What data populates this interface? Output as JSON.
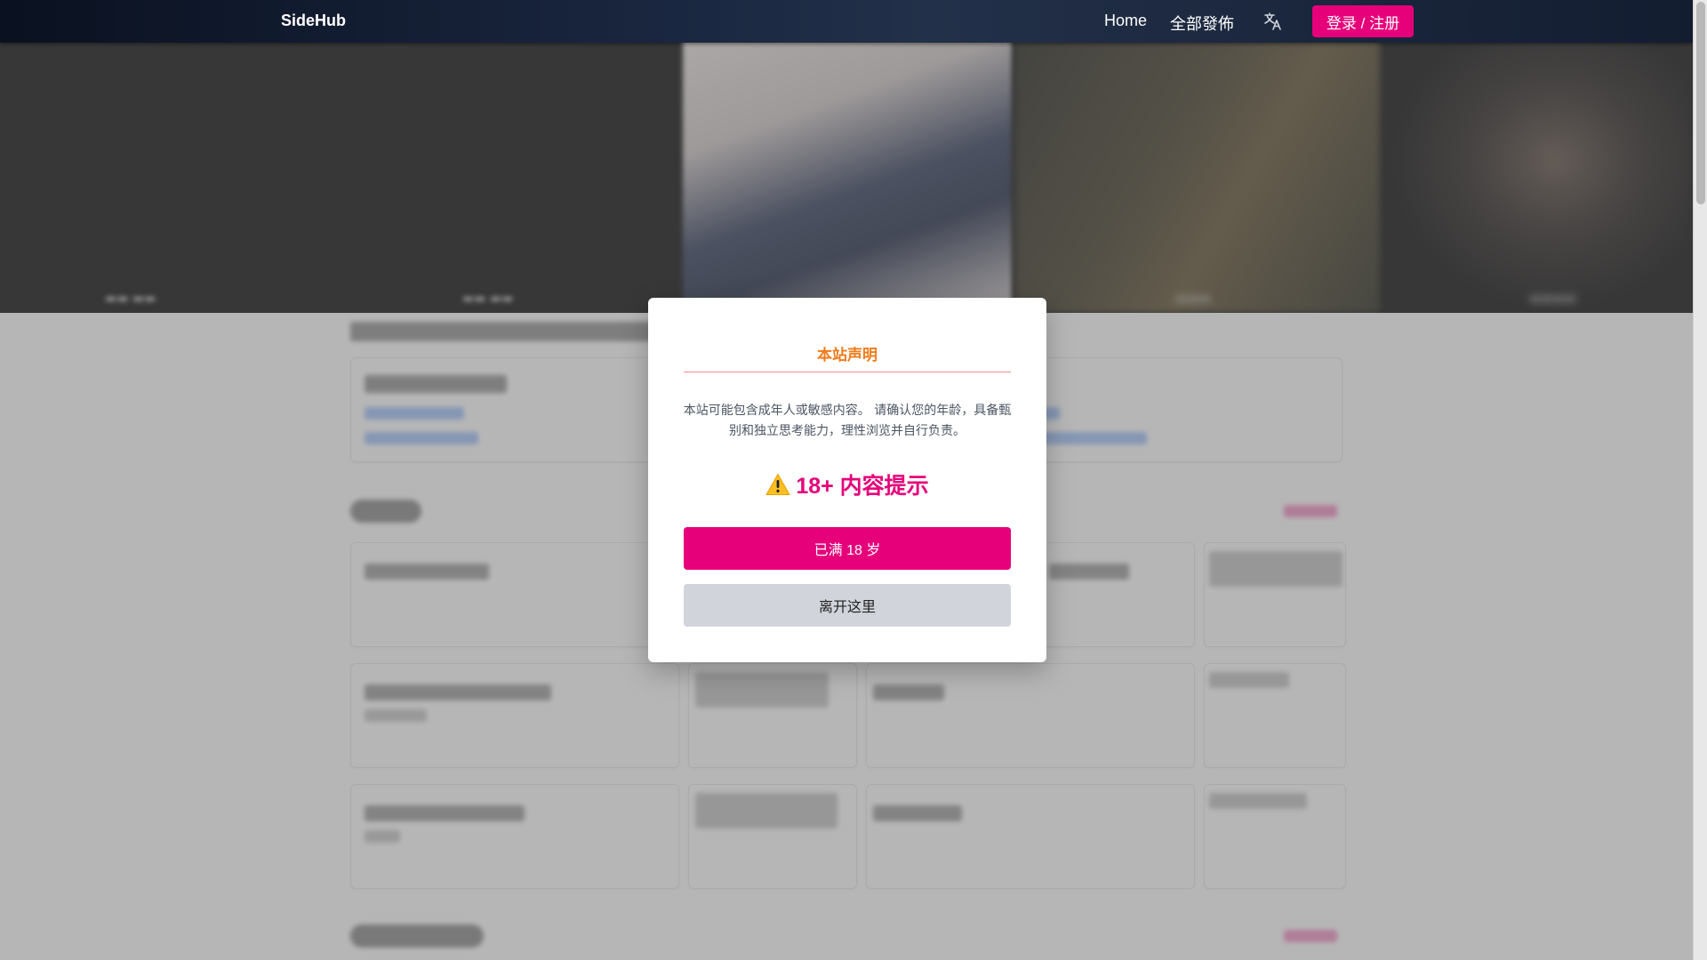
{
  "navbar": {
    "brand": "SideHub",
    "links": [
      "Home",
      "全部發佈"
    ],
    "translate_icon": "translate-icon",
    "login_label": "登录 / 注册"
  },
  "modal": {
    "title": "本站声明",
    "body": "本站可能包含成年人或敏感内容。 请确认您的年龄，具备甄别和独立思考能力，理性浏览并自行负责。",
    "warning_icon": "warning-icon",
    "warning_text": "18+ 内容提示",
    "confirm_label": "已满 18 岁",
    "leave_label": "离开这里"
  },
  "colors": {
    "accent": "#e6007a",
    "title_orange": "#f07b1a",
    "leave_bg": "#d1d5db"
  }
}
